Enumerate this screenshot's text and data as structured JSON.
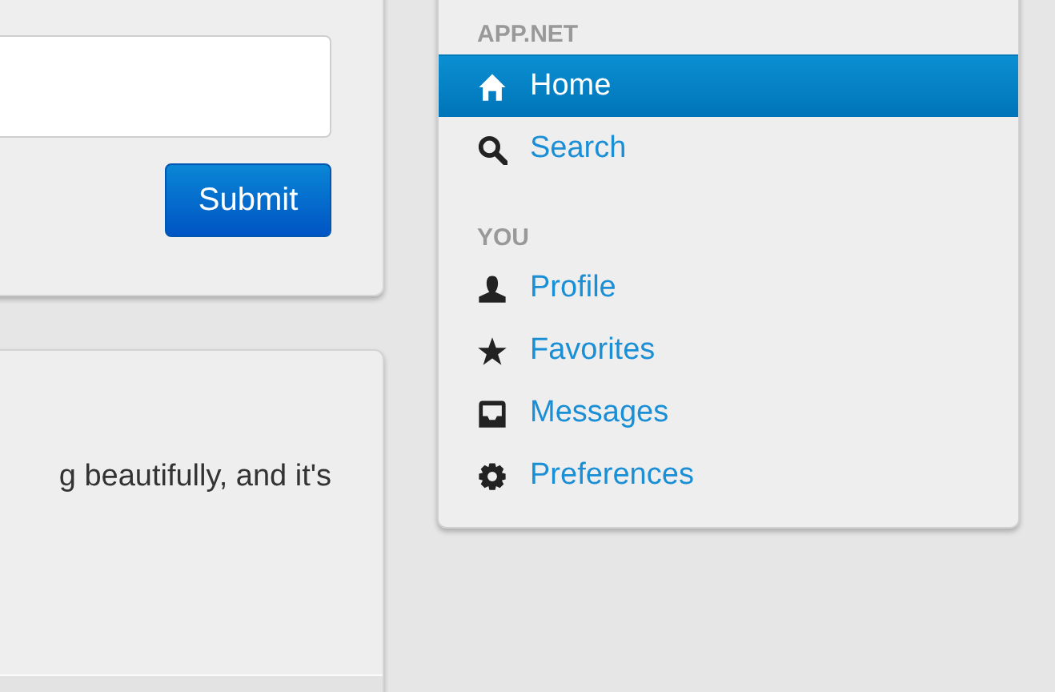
{
  "post_form": {
    "submit_label": "Submit"
  },
  "post": {
    "text": "g beautifully, and it's"
  },
  "sidebar": {
    "sections": [
      {
        "label": "APP.NET",
        "items": [
          {
            "label": "Home",
            "selected": true
          },
          {
            "label": "Search",
            "selected": false
          }
        ]
      },
      {
        "label": "YOU",
        "items": [
          {
            "label": "Profile",
            "selected": false
          },
          {
            "label": "Favorites",
            "selected": false
          },
          {
            "label": "Messages",
            "selected": false
          },
          {
            "label": "Preferences",
            "selected": false
          }
        ]
      }
    ]
  }
}
